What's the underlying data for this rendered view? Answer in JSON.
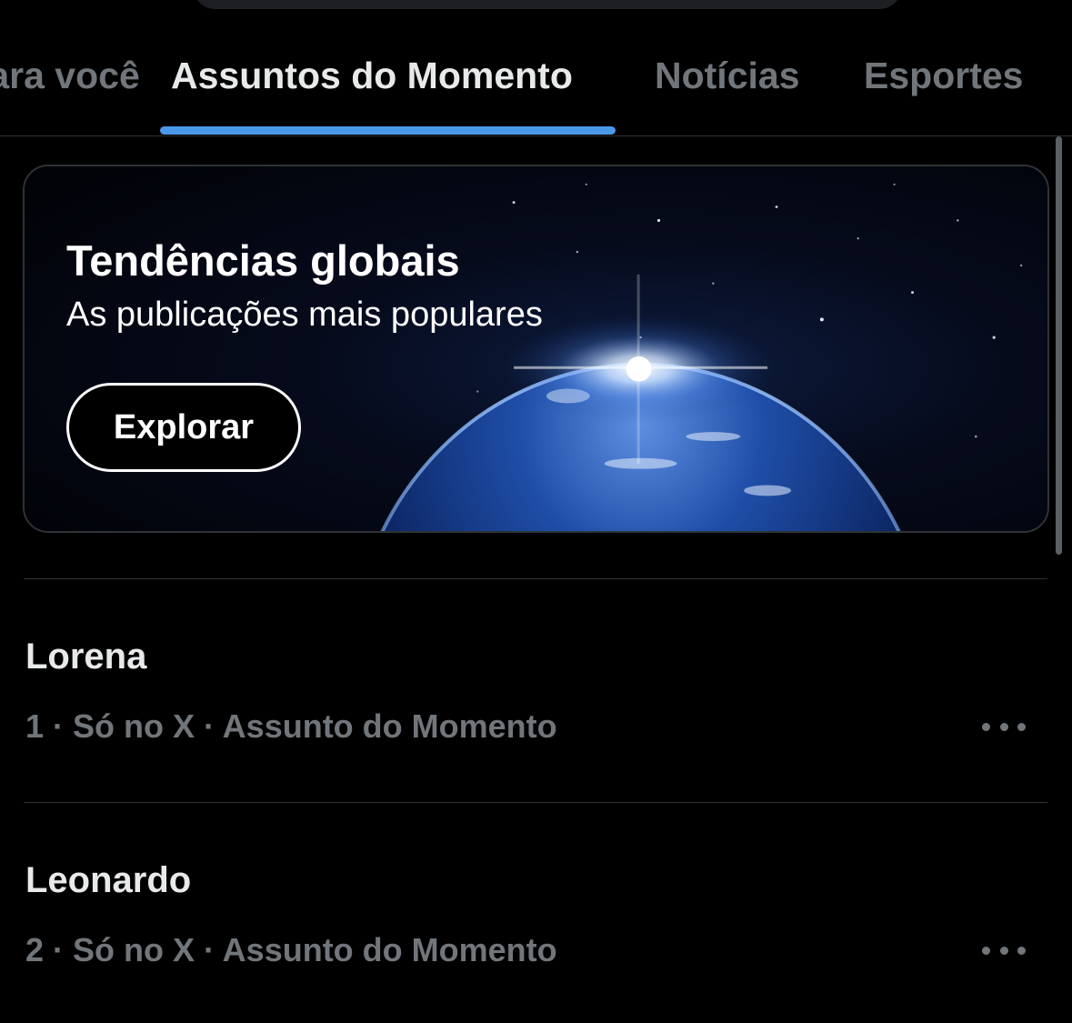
{
  "tabs": [
    {
      "label": "Para você",
      "active": false
    },
    {
      "label": "Assuntos do Momento",
      "active": true
    },
    {
      "label": "Notícias",
      "active": false
    },
    {
      "label": "Esportes",
      "active": false
    }
  ],
  "banner": {
    "title": "Tendências globais",
    "subtitle": "As publicações mais populares",
    "button_label": "Explorar",
    "background": "earth-from-space-image"
  },
  "trends": [
    {
      "name": "Lorena",
      "rank": "1",
      "meta": "1 · Só no X · Assunto do Momento",
      "menu_icon": "more-icon"
    },
    {
      "name": "Leonardo",
      "rank": "2",
      "meta": "2 · Só no X · Assunto do Momento",
      "menu_icon": "more-icon"
    }
  ],
  "colors": {
    "background": "#000000",
    "accent": "#4a99e9",
    "text_primary": "#e7e9ea",
    "text_secondary": "#71767b",
    "divider": "#2f3336"
  }
}
